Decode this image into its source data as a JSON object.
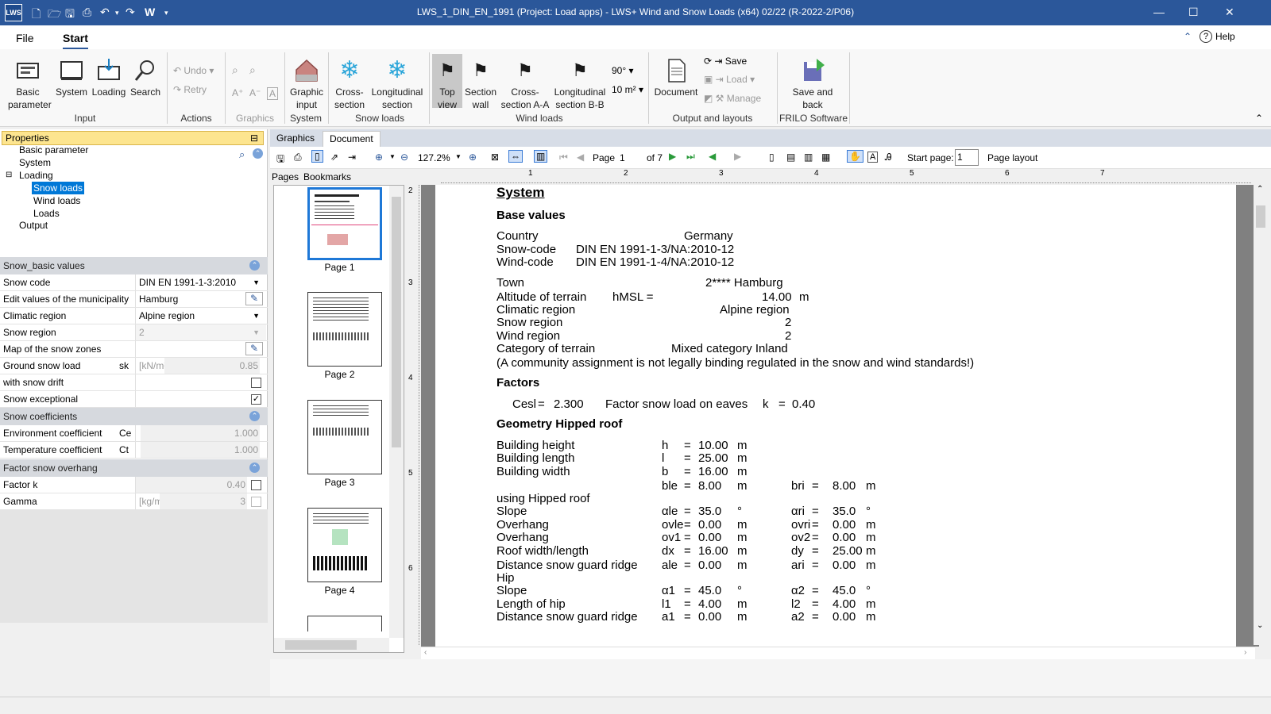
{
  "window": {
    "title": "LWS_1_DIN_EN_1991 (Project: Load apps) - LWS+ Wind and Snow Loads (x64) 02/22 (R-2022-2/P06)",
    "logo": "LWS"
  },
  "menu": {
    "file": "File",
    "start": "Start",
    "help": "Help"
  },
  "ribbon": {
    "basic_parameter": "Basic parameter",
    "system": "System",
    "loading": "Loading",
    "search": "Search",
    "undo": "Undo",
    "retry": "Retry",
    "graphic_input": "Graphic input",
    "cross_section": "Cross-section",
    "longitudinal_section": "Longitudinal section",
    "top_view": "Top view",
    "section_wall": "Section wall",
    "cross_section_aa": "Cross-section A-A",
    "longitudinal_section_bb": "Longitudinal section B-B",
    "angle": "90°",
    "area": "10 m²",
    "document": "Document",
    "save": "Save",
    "load": "Load",
    "manage": "Manage",
    "save_and_back": "Save and back",
    "groups": {
      "input": "Input",
      "actions": "Actions",
      "graphics": "Graphics",
      "system": "System",
      "snow_loads": "Snow loads",
      "wind_loads": "Wind loads",
      "output": "Output and layouts",
      "frilo": "FRILO Software"
    }
  },
  "properties": {
    "header": "Properties",
    "tree": [
      "Basic parameter",
      "System",
      "Loading",
      "Snow loads",
      "Wind loads",
      "Loads",
      "Output"
    ],
    "sections": {
      "basic": "Snow_basic values",
      "coeff": "Snow coefficients",
      "overhang": "Factor snow overhang"
    },
    "rows": {
      "snow_code": {
        "label": "Snow code",
        "value": "DIN EN 1991-1-3:2010"
      },
      "municipality": {
        "label": "Edit values of the municipality",
        "value": "Hamburg"
      },
      "climatic": {
        "label": "Climatic region",
        "value": "Alpine region"
      },
      "snow_region": {
        "label": "Snow region",
        "value": "2"
      },
      "map": {
        "label": "Map of the snow zones"
      },
      "ground": {
        "label": "Ground snow load",
        "sym": "sk",
        "unit": "[kN/m²]",
        "value": "0.85"
      },
      "drift": {
        "label": "with snow drift"
      },
      "exceptional": {
        "label": "Snow exceptional",
        "check": "✓"
      },
      "env": {
        "label": "Environment coefficient",
        "sym": "Ce",
        "value": "1.000"
      },
      "temp": {
        "label": "Temperature coefficient",
        "sym": "Ct",
        "value": "1.000"
      },
      "factork": {
        "label": "Factor k",
        "value": "0.40"
      },
      "gamma": {
        "label": "Gamma",
        "unit": "[kg/m³]",
        "value": "3"
      }
    }
  },
  "doctabs": {
    "graphics": "Graphics",
    "document": "Document",
    "pages": "Pages",
    "bookmarks": "Bookmarks"
  },
  "doctoolbar": {
    "zoom": "127.2%",
    "page_label": "Page",
    "page": "1",
    "of": "of 7",
    "start_page_label": "Start page:",
    "start_page": "1",
    "page_layout": "Page layout"
  },
  "thumbs": [
    "Page 1",
    "Page 2",
    "Page 3",
    "Page 4"
  ],
  "ruler": [
    "1",
    "2",
    "3",
    "4",
    "5",
    "6",
    "7"
  ],
  "vruler": [
    "2",
    "3",
    "4",
    "5",
    "6"
  ],
  "doc": {
    "system": "System",
    "base_values": "Base values",
    "country_l": "Country",
    "country_v": "Germany",
    "snowcode_l": "Snow-code",
    "snowcode_v": "DIN EN 1991-1-3/NA:2010-12",
    "windcode_l": "Wind-code",
    "windcode_v": "DIN EN 1991-1-4/NA:2010-12",
    "town_l": "Town",
    "town_v": "2**** Hamburg",
    "alt_l": "Altitude of terrain",
    "alt_s": "hMSL  =",
    "alt_v": "14.00",
    "alt_u": "m",
    "clim_l": "Climatic region",
    "clim_v": "Alpine region",
    "snowr_l": "Snow region",
    "snowr_v": "2",
    "windr_l": "Wind region",
    "windr_v": "2",
    "cat_l": "Category of terrain",
    "cat_v": "Mixed category Inland",
    "note": "(A community assignment is not legally binding regulated in the snow and wind standards!)",
    "factors": "Factors",
    "ces_l": "Cesl",
    "ces_eq": "=",
    "ces_v": "2.300",
    "eaves_l": "Factor snow load on eaves",
    "eaves_s": "k",
    "eaves_eq": "=",
    "eaves_v": "0.40",
    "geom": "Geometry Hipped roof",
    "rows": [
      {
        "l": "Building height",
        "s": "h",
        "v": "10.00",
        "u": "m"
      },
      {
        "l": "Building length",
        "s": "l",
        "v": "25.00",
        "u": "m"
      },
      {
        "l": "Building width",
        "s": "b",
        "v": "16.00",
        "u": "m"
      },
      {
        "l": "",
        "s": "ble",
        "v": "8.00",
        "u": "m",
        "s2": "bri",
        "v2": "8.00",
        "u2": "m"
      },
      {
        "l": "using Hipped roof",
        "s": "",
        "v": "",
        "u": ""
      },
      {
        "l": "Slope",
        "s": "αle",
        "v": "35.0",
        "u": "°",
        "s2": "αri",
        "v2": "35.0",
        "u2": "°"
      },
      {
        "l": "Overhang",
        "s": "ovle",
        "v": "0.00",
        "u": "m",
        "s2": "ovri",
        "v2": "0.00",
        "u2": "m"
      },
      {
        "l": "Overhang",
        "s": "ov1",
        "v": "0.00",
        "u": "m",
        "s2": "ov2",
        "v2": "0.00",
        "u2": "m"
      },
      {
        "l": "Roof width/length",
        "s": "dx",
        "v": "16.00",
        "u": "m",
        "s2": "dy",
        "v2": "25.00",
        "u2": "m"
      },
      {
        "l": "Distance snow guard ridge",
        "s": "ale",
        "v": "0.00",
        "u": "m",
        "s2": "ari",
        "v2": "0.00",
        "u2": "m"
      },
      {
        "l": "Hip",
        "s": "",
        "v": "",
        "u": ""
      },
      {
        "l": "Slope",
        "s": "α1",
        "v": "45.0",
        "u": "°",
        "s2": "α2",
        "v2": "45.0",
        "u2": "°"
      },
      {
        "l": "Length of hip",
        "s": "l1",
        "v": "4.00",
        "u": "m",
        "s2": "l2",
        "v2": "4.00",
        "u2": "m"
      },
      {
        "l": "Distance snow guard ridge",
        "s": "a1",
        "v": "0.00",
        "u": "m",
        "s2": "a2",
        "v2": "0.00",
        "u2": "m"
      }
    ]
  }
}
